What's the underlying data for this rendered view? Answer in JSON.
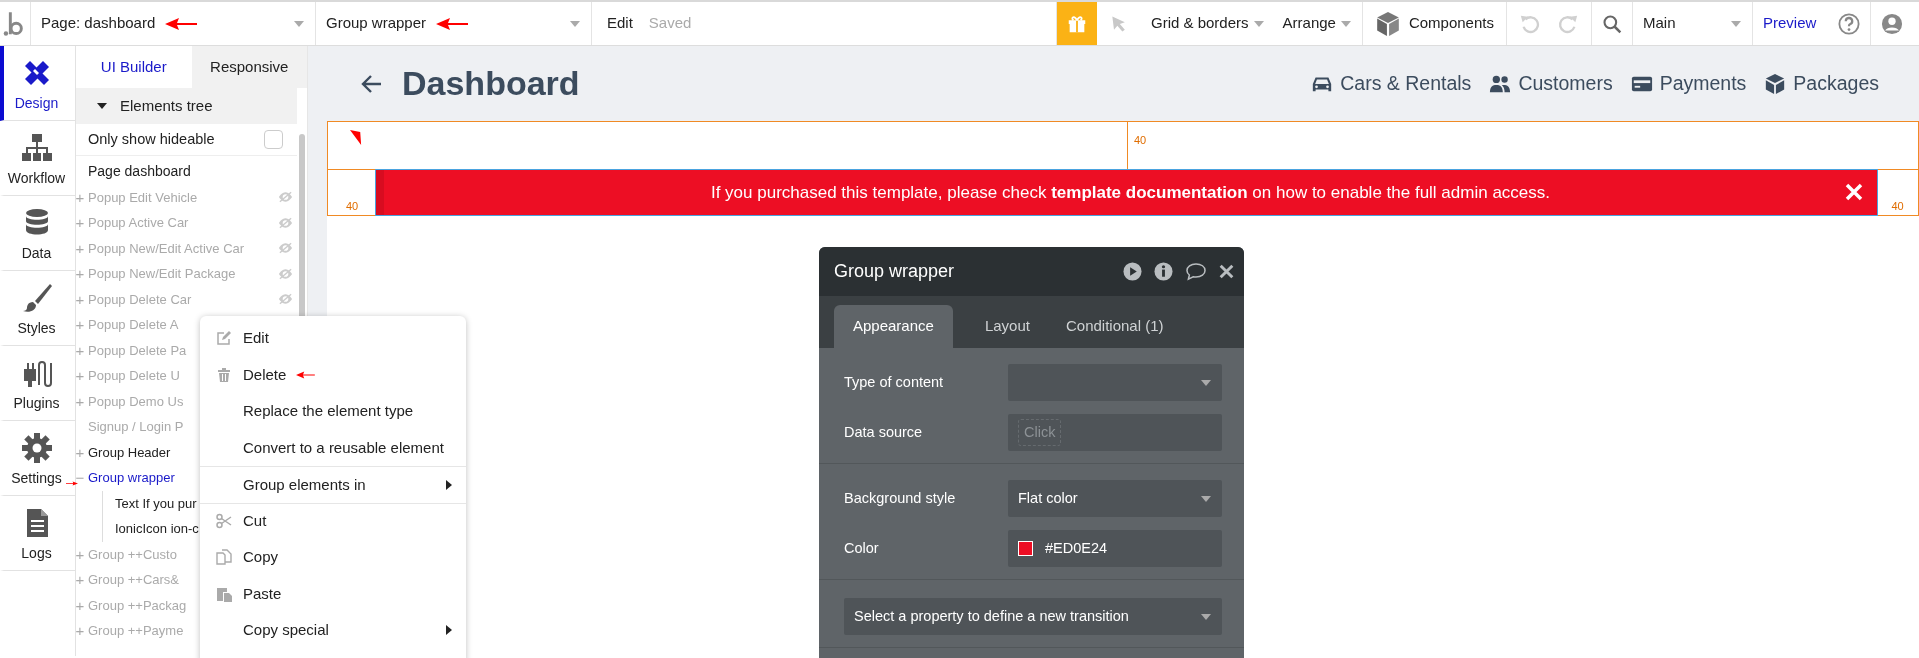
{
  "toolbar": {
    "page_selector": "Page: dashboard",
    "element_selector": "Group wrapper",
    "edit_label": "Edit",
    "save_status": "Saved",
    "grid_menu": "Grid & borders",
    "arrange_menu": "Arrange",
    "components_button": "Components",
    "branch_selector": "Main",
    "preview_link": "Preview"
  },
  "nav_rail": [
    {
      "label": "Design",
      "selected": true
    },
    {
      "label": "Workflow",
      "selected": false
    },
    {
      "label": "Data",
      "selected": false
    },
    {
      "label": "Styles",
      "selected": false
    },
    {
      "label": "Plugins",
      "selected": false
    },
    {
      "label": "Settings",
      "selected": false
    },
    {
      "label": "Logs",
      "selected": false
    }
  ],
  "panel_tabs": [
    {
      "label": "UI Builder",
      "selected": true
    },
    {
      "label": "Responsive",
      "selected": false
    }
  ],
  "elements_tree": {
    "title": "Elements tree",
    "expanded": true,
    "filter": {
      "label": "Only show hideable",
      "checked": false
    },
    "page": "Page dashboard",
    "items": [
      {
        "expander": "+",
        "label": "Popup Edit Vehicle",
        "hidden": true,
        "visibility_icon": true,
        "selected": false
      },
      {
        "expander": "+",
        "label": "Popup Active Car",
        "hidden": true,
        "visibility_icon": true,
        "selected": false
      },
      {
        "expander": "+",
        "label": "Popup New/Edit Active Car",
        "hidden": true,
        "visibility_icon": true,
        "selected": false
      },
      {
        "expander": "+",
        "label": "Popup New/Edit Package",
        "hidden": true,
        "visibility_icon": true,
        "selected": false
      },
      {
        "expander": "+",
        "label": "Popup Delete Car",
        "hidden": true,
        "visibility_icon": true,
        "selected": false
      },
      {
        "expander": "+",
        "label": "Popup Delete A",
        "hidden": true,
        "visibility_icon": false,
        "selected": false
      },
      {
        "expander": "+",
        "label": "Popup Delete Pa",
        "hidden": true,
        "visibility_icon": false,
        "selected": false
      },
      {
        "expander": "+",
        "label": "Popup Delete U",
        "hidden": true,
        "visibility_icon": false,
        "selected": false
      },
      {
        "expander": "+",
        "label": "Popup Demo Us",
        "hidden": true,
        "visibility_icon": false,
        "selected": false
      },
      {
        "label": "Signup / Login P",
        "hidden": true,
        "visibility_icon": false,
        "selected": false
      },
      {
        "expander": "+",
        "label": "Group Header",
        "hidden": false,
        "visibility_icon": false,
        "selected": false
      },
      {
        "expander": "−",
        "label": "Group wrapper",
        "hidden": false,
        "visibility_icon": false,
        "selected": true,
        "children": [
          {
            "label": "Text If you pur",
            "hidden": false,
            "visibility_icon": false,
            "selected": false
          },
          {
            "label": "IonicIcon ion-c",
            "hidden": false,
            "visibility_icon": false,
            "selected": false
          }
        ]
      },
      {
        "expander": "+",
        "label": "Group ++Custo",
        "hidden": true,
        "visibility_icon": false,
        "selected": false
      },
      {
        "expander": "+",
        "label": "Group ++Cars&",
        "hidden": true,
        "visibility_icon": false,
        "selected": false
      },
      {
        "expander": "+",
        "label": "Group ++Packag",
        "hidden": true,
        "visibility_icon": false,
        "selected": false
      },
      {
        "expander": "+",
        "label": "Group ++Payme",
        "hidden": true,
        "visibility_icon": false,
        "selected": false
      }
    ]
  },
  "canvas": {
    "title": "Dashboard",
    "nav": [
      {
        "label": "Cars & Rentals"
      },
      {
        "label": "Customers"
      },
      {
        "label": "Payments"
      },
      {
        "label": "Packages"
      }
    ],
    "gap_labels": [
      "40",
      "40",
      "40"
    ],
    "banner": "If you purchased this template, please check **template documentation** on how to enable the full admin access."
  },
  "context_menu": [
    {
      "kind": "edit",
      "label": "Edit",
      "divider_before": false,
      "submenu": false
    },
    {
      "kind": "delete",
      "label": "Delete",
      "divider_before": false,
      "submenu": false
    },
    {
      "kind": "plain",
      "label": "Replace the element type",
      "divider_before": false,
      "submenu": false
    },
    {
      "kind": "plain",
      "label": "Convert to a reusable element",
      "divider_before": false,
      "submenu": false
    },
    {
      "kind": "plain",
      "label": "Group elements in",
      "divider_before": true,
      "submenu": true
    },
    {
      "kind": "cut",
      "label": "Cut",
      "divider_before": true,
      "submenu": false
    },
    {
      "kind": "copy",
      "label": "Copy",
      "divider_before": false,
      "submenu": false
    },
    {
      "kind": "paste",
      "label": "Paste",
      "divider_before": false,
      "submenu": false
    },
    {
      "kind": "plain",
      "label": "Copy special",
      "divider_before": false,
      "submenu": true
    }
  ],
  "property_editor": {
    "title": "Group wrapper",
    "tabs": [
      {
        "label": "Appearance",
        "selected": true
      },
      {
        "label": "Layout",
        "selected": false
      },
      {
        "label": "Conditional (1)",
        "selected": false
      }
    ],
    "sections": [
      {
        "fields": [
          {
            "kind": "dropdown",
            "label": "Type of content"
          },
          {
            "kind": "expression",
            "label": "Data source",
            "placeholder": "Click"
          }
        ]
      },
      {
        "fields": [
          {
            "kind": "dropdown",
            "label": "Background style",
            "value": "Flat color"
          },
          {
            "kind": "color",
            "label": "Color",
            "value": "#ED0E24",
            "color": "#ed0e24"
          }
        ]
      },
      {
        "fields": [
          {
            "kind": "wide_dropdown",
            "value": "Select a property to define a new transition"
          }
        ]
      }
    ]
  }
}
